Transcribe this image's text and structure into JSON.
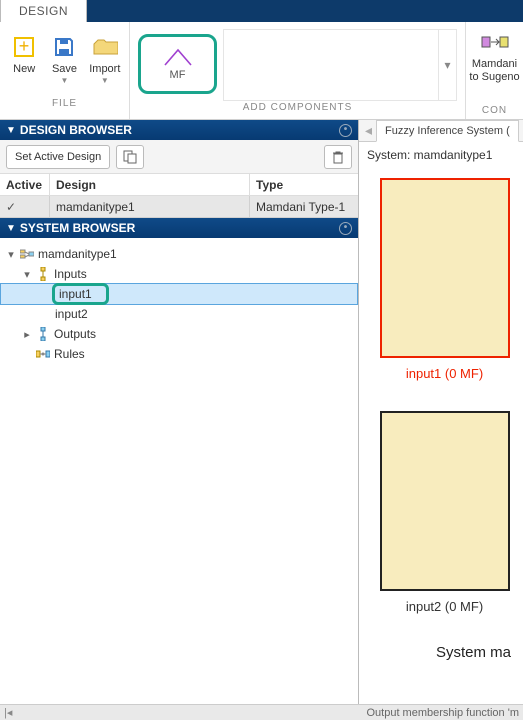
{
  "tab": {
    "design": "DESIGN"
  },
  "ribbon": {
    "file": {
      "new": "New",
      "save": "Save",
      "import": "Import",
      "section": "FILE"
    },
    "add": {
      "mf": "MF",
      "section": "ADD COMPONENTS"
    },
    "convert": {
      "line1": "Mamdani",
      "line2": "to Sugeno",
      "section": "CON"
    }
  },
  "designBrowser": {
    "title": "DESIGN BROWSER",
    "setActive": "Set Active Design",
    "headers": {
      "active": "Active",
      "design": "Design",
      "type": "Type"
    },
    "rows": [
      {
        "active": "✓",
        "design": "mamdanitype1",
        "type": "Mamdani Type-1"
      }
    ]
  },
  "systemBrowser": {
    "title": "SYSTEM BROWSER",
    "root": "mamdanitype1",
    "inputs": "Inputs",
    "input1": "input1",
    "input2": "input2",
    "outputs": "Outputs",
    "rules": "Rules"
  },
  "rightPanel": {
    "tab": "Fuzzy Inference System (",
    "system": "System: mamdanitype1",
    "input1": "input1 (0 MF)",
    "input2": "input2 (0 MF)",
    "systemMa": "System ma"
  },
  "status": {
    "text": "Output membership function 'm"
  }
}
